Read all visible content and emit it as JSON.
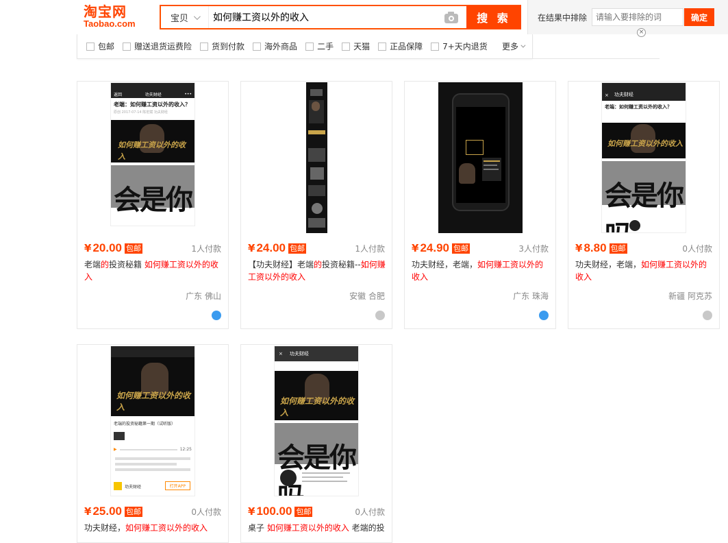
{
  "header": {
    "logo_cn": "淘宝网",
    "logo_en": "Taobao.com",
    "search_category": "宝贝",
    "search_query": "如何赚工资以外的收入",
    "search_button": "搜 索",
    "exclude_label": "在结果中排除",
    "exclude_placeholder": "请输入要排除的词",
    "exclude_button": "确定",
    "close_glyph": "×"
  },
  "filters": [
    {
      "label": "包邮"
    },
    {
      "label": "赠送退货运费险"
    },
    {
      "label": "货到付款"
    },
    {
      "label": "海外商品"
    },
    {
      "label": "二手"
    },
    {
      "label": "天猫"
    },
    {
      "label": "正品保障"
    },
    {
      "label": "7+天内退货"
    }
  ],
  "more_label": "更多",
  "currency": "¥",
  "free_shipping_label": "包邮",
  "products": [
    {
      "price": "20.00",
      "deals": "1人付款",
      "title_pre": "老端",
      "title_hl1": "的",
      "title_mid": "投资秘籍 ",
      "title_hl2": "如何赚工资以外的收入",
      "title_post": "",
      "location": "广东 佛山",
      "badge": "blue",
      "poster_text": "如何赚工资以外的收入",
      "article_title": "老端：如何赚工资以外的收入？",
      "article_meta": "原创 2017-07-14 陈宏斌 功夫财经",
      "app_title": "功夫财经",
      "back_label": "返回",
      "video_text": "会是你吗"
    },
    {
      "price": "24.00",
      "deals": "1人付款",
      "title_pre": "【功夫财经】老端",
      "title_hl1": "的",
      "title_mid": "投资秘籍--",
      "title_hl2": "如何赚工资以外的收入",
      "title_post": "",
      "location": "安徽 合肥",
      "badge": "grey"
    },
    {
      "price": "24.90",
      "deals": "3人付款",
      "title_pre": "功夫财经，老端，",
      "title_hl1": "",
      "title_mid": "",
      "title_hl2": "如何赚工资以外的收入",
      "title_post": "",
      "location": "广东 珠海",
      "badge": "blue"
    },
    {
      "price": "8.80",
      "deals": "0人付款",
      "title_pre": "功夫财经，老端，",
      "title_hl1": "",
      "title_mid": "",
      "title_hl2": "如何赚工资以外的收入",
      "title_post": "",
      "location": "新疆 阿克苏",
      "badge": "grey",
      "article_title": "老端：如何赚工资以外的收入？",
      "app_title": "功夫财经",
      "poster_text": "如何赚工资以外的收入",
      "video_text": "会是你吗"
    },
    {
      "price": "25.00",
      "deals": "0人付款",
      "title_pre": "功夫财经，",
      "title_hl1": "",
      "title_mid": "",
      "title_hl2": "如何赚工资以外的收入",
      "title_post": "",
      "poster_text": "如何赚工资以外的收入",
      "episode_title": "老端的投资秘籍第一期（试听版）",
      "player_time": "12:25",
      "app_name": "功夫财经",
      "open_app": "打开APP"
    },
    {
      "price": "100.00",
      "deals": "0人付款",
      "title_pre": "桌子 ",
      "title_hl1": "",
      "title_mid": "",
      "title_hl2": "如何赚工资以外的收入",
      "title_post": " 老端的投",
      "app_title": "功夫财经",
      "poster_text": "如何赚工资以外的收入",
      "video_text": "会是你吗"
    }
  ],
  "colors": {
    "brand": "#ff4400",
    "highlight": "#ff0000",
    "muted": "#888888"
  }
}
